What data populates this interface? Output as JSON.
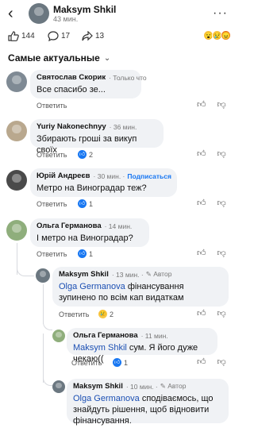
{
  "header": {
    "name": "Maksym Shkil",
    "time": "43 мин."
  },
  "stats": {
    "likes": "144",
    "comments": "17",
    "shares": "13"
  },
  "sort_label": "Самые актуальные",
  "reply_label": "Ответить",
  "comments": [
    {
      "author": "Святослав Скорик",
      "meta": "· Только что",
      "text": "Все спасибо зе...",
      "count": ""
    },
    {
      "author": "Yuriy Nakonechnyy",
      "meta": "· 36 мин.",
      "text": "Збирають гроші за викуп своїх",
      "count": "2"
    },
    {
      "author": "Юрій Андреєв",
      "meta": "· 30 мин. ·",
      "follow": "Подписаться",
      "text": "Метро на Виноградар теж?",
      "count": "1"
    },
    {
      "author": "Ольга Германова",
      "meta": "· 14 мин.",
      "text": "І метро на Виноградар?",
      "count": "1"
    },
    {
      "author": "Maksym Shkil",
      "meta": "· 13 мин. ·",
      "badge": "Автор",
      "mention": "Olga Germanova",
      "text": " фінансування зупинено по всім кап видаткам",
      "count": "2"
    },
    {
      "author": "Ольга Германова",
      "meta": "· 11 мин.",
      "mention": "Maksym Shkil",
      "text": " сум. Я його дуже чекаю((",
      "count": "1"
    },
    {
      "author": "Maksym Shkil",
      "meta": "· 10 мин. ·",
      "badge": "Автор",
      "mention": "Olga Germanova",
      "text": " сподіваємось, що знайдуть рішення, щоб відновити фінансування."
    }
  ]
}
